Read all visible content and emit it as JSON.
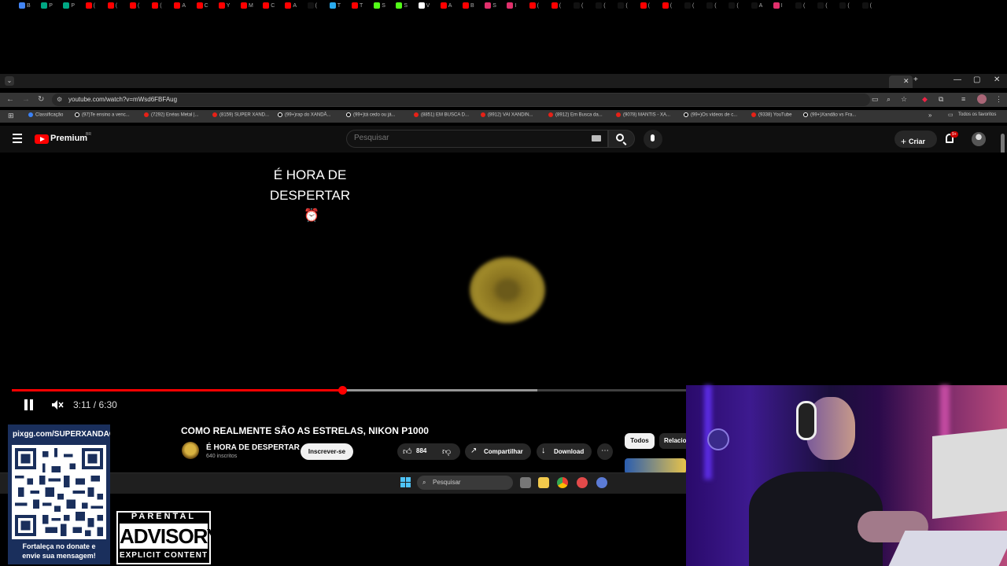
{
  "browser": {
    "url": "youtube.com/watch?v=mWsd6FBFAug",
    "tabs": [
      {
        "letter": "B",
        "color": "#4285f4"
      },
      {
        "letter": "P",
        "color": "#00a884"
      },
      {
        "letter": "P",
        "color": "#00a884"
      },
      {
        "letter": "(",
        "color": "#ff0000"
      },
      {
        "letter": "(",
        "color": "#ff0000"
      },
      {
        "letter": "(",
        "color": "#ff0000"
      },
      {
        "letter": "(",
        "color": "#ff0000"
      },
      {
        "letter": "A",
        "color": "#ff0000"
      },
      {
        "letter": "C",
        "color": "#ff0000"
      },
      {
        "letter": "Y",
        "color": "#ff0000"
      },
      {
        "letter": "M",
        "color": "#ff0000"
      },
      {
        "letter": "C",
        "color": "#ff0000"
      },
      {
        "letter": "A",
        "color": "#ff0000"
      },
      {
        "letter": "(",
        "color": "#111111"
      },
      {
        "letter": "T",
        "color": "#2aabee"
      },
      {
        "letter": "T",
        "color": "#ff0000"
      },
      {
        "letter": "S",
        "color": "#53fc18"
      },
      {
        "letter": "S",
        "color": "#53fc18"
      },
      {
        "letter": "V",
        "color": "#ffffff"
      },
      {
        "letter": "A",
        "color": "#ff0000"
      },
      {
        "letter": "B",
        "color": "#ff0000"
      },
      {
        "letter": "S",
        "color": "#e1306c"
      },
      {
        "letter": "I",
        "color": "#e1306c"
      },
      {
        "letter": "(",
        "color": "#ff0000"
      },
      {
        "letter": "(",
        "color": "#ff0000"
      },
      {
        "letter": "(",
        "color": "#111111"
      },
      {
        "letter": "(",
        "color": "#111111"
      },
      {
        "letter": "(",
        "color": "#111111"
      },
      {
        "letter": "(",
        "color": "#ff0000"
      },
      {
        "letter": "(",
        "color": "#ff0000"
      },
      {
        "letter": "(",
        "color": "#111111"
      },
      {
        "letter": "(",
        "color": "#111111"
      },
      {
        "letter": "(",
        "color": "#111111"
      },
      {
        "letter": "A",
        "color": "#111111"
      },
      {
        "letter": "I",
        "color": "#e1306c"
      },
      {
        "letter": "(",
        "color": "#111111"
      },
      {
        "letter": "(",
        "color": "#111111"
      },
      {
        "letter": "(",
        "color": "#111111"
      },
      {
        "letter": "(",
        "color": "#111111"
      }
    ],
    "bookmarks": [
      {
        "label": "Classificação",
        "kind": "bl"
      },
      {
        "label": "(97)Te ensino a venc...",
        "kind": "tt"
      },
      {
        "label": "(7292) Enéas Metal |...",
        "kind": "yt"
      },
      {
        "label": "(8159) SUPER XAND...",
        "kind": "yt"
      },
      {
        "label": "(99+)rap do XANDÃ...",
        "kind": "tt"
      },
      {
        "label": "(99+)tá cedo ou já...",
        "kind": "tt"
      },
      {
        "label": "(8851) EM BUSCA D...",
        "kind": "yt"
      },
      {
        "label": "(8912) VAI XANDIN...",
        "kind": "yt"
      },
      {
        "label": "(8912) Em Busca da...",
        "kind": "yt"
      },
      {
        "label": "(9078) MANTIS - XA...",
        "kind": "yt"
      },
      {
        "label": "(99+)Os vídeos de c...",
        "kind": "tt"
      },
      {
        "label": "(9338) YouTube",
        "kind": "yt"
      },
      {
        "label": "(99+)Xandão vs Fra...",
        "kind": "tt"
      }
    ],
    "all_bookmarks": "Todos os favoritos"
  },
  "youtube": {
    "brand": "Premium",
    "country": "BR",
    "search_placeholder": "Pesquisar",
    "create_label": "Criar",
    "notifications": "9+"
  },
  "player": {
    "caption_line1": "É HORA DE",
    "caption_line2": "DESPERTAR",
    "caption_icon": "alarm-clock-icon",
    "current_time": "3:11",
    "duration": "6:30",
    "time_display": "3:11 / 6:30",
    "progress_fraction": 0.49,
    "muted": true,
    "playing": true
  },
  "video": {
    "title": "COMO REALMENTE SÃO AS ESTRELAS, NIKON P1000",
    "channel": "É HORA DE DESPERTAR",
    "subscribers": "640 inscritos",
    "subscribe_label": "Inscrever-se",
    "likes": "884",
    "share_label": "Compartilhar",
    "download_label": "Download"
  },
  "chips": {
    "all": "Todos",
    "related": "Relacio"
  },
  "taskbar": {
    "search_placeholder": "Pesquisar"
  },
  "overlay": {
    "donate_url": "pixgg.com/SUPERXANDAO",
    "donate_text_1": "Fortaleça no donate e",
    "donate_text_2": "envie sua mensagem!",
    "advisory_top": "PARENTAL",
    "advisory_mid": "ADVISORY",
    "advisory_bottom": "EXPLICIT CONTENT"
  },
  "colors": {
    "youtube_red": "#ff0000",
    "page_bg": "#0f0f0f",
    "donate_panel": "#1a2f5c"
  }
}
